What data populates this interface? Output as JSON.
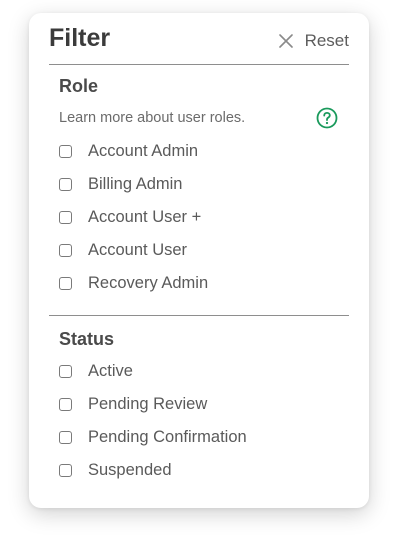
{
  "header": {
    "title": "Filter",
    "reset_label": "Reset"
  },
  "role": {
    "title": "Role",
    "learn_more": "Learn more about user roles.",
    "help_icon": "question-circle-icon",
    "accent_color": "#1a9a5c",
    "options": [
      {
        "label": "Account Admin",
        "checked": false
      },
      {
        "label": "Billing Admin",
        "checked": false
      },
      {
        "label": "Account User +",
        "checked": false
      },
      {
        "label": "Account User",
        "checked": false
      },
      {
        "label": "Recovery Admin",
        "checked": false
      }
    ]
  },
  "status": {
    "title": "Status",
    "options": [
      {
        "label": "Active",
        "checked": false
      },
      {
        "label": "Pending Review",
        "checked": false
      },
      {
        "label": "Pending Confirmation",
        "checked": false
      },
      {
        "label": "Suspended",
        "checked": false
      }
    ]
  }
}
